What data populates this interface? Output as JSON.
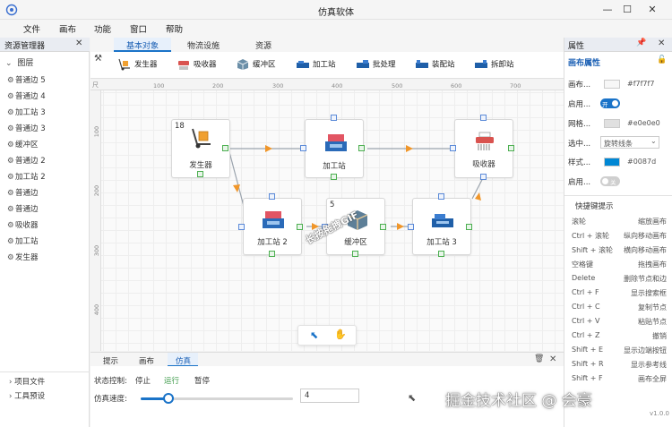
{
  "window": {
    "title": "仿真软体",
    "minimize": "—",
    "maximize": "☐",
    "close": "✕"
  },
  "menu": [
    "文件",
    "画布",
    "功能",
    "窗口",
    "帮助"
  ],
  "left_panel": {
    "title": "资源管理器",
    "group": "图层",
    "items": [
      "普通边 5",
      "普通边 4",
      "加工站 3",
      "普通边 3",
      "缓冲区",
      "普通边 2",
      "加工站 2",
      "普通边",
      "普通边",
      "吸收器",
      "加工站",
      "发生器"
    ],
    "footer_items": [
      "项目文件",
      "工具预设"
    ]
  },
  "tabs": [
    "基本对象",
    "物流设施",
    "资源"
  ],
  "toolbar": [
    "发生器",
    "吸收器",
    "缓冲区",
    "加工站",
    "批处理",
    "装配站",
    "拆卸站"
  ],
  "ruler": {
    "top": [
      "100",
      "200",
      "300",
      "400",
      "500",
      "600",
      "700"
    ],
    "left": [
      "100",
      "200",
      "300",
      "400"
    ],
    "corner": "尺"
  },
  "nodes": {
    "generator": {
      "label": "发生器",
      "count": "18"
    },
    "station1": {
      "label": "加工站"
    },
    "absorber": {
      "label": "吸收器"
    },
    "station2": {
      "label": "加工站 2"
    },
    "buffer": {
      "label": "缓冲区",
      "count": "5"
    },
    "station3": {
      "label": "加工站 3"
    }
  },
  "stamp": "长按拖拽GIF",
  "bottom": {
    "tabs": [
      "提示",
      "画布",
      "仿真"
    ],
    "state_label": "状态控制:",
    "stop": "停止",
    "run": "运行",
    "pause": "暂停",
    "speed_label": "仿真速度:",
    "speed_value": "4",
    "speed_fraction": 0.18
  },
  "right_panel": {
    "title": "属性",
    "subtitle": "画布属性",
    "props": [
      {
        "label": "画布...",
        "value": "#f7f7f7",
        "swatch": "#f7f7f7"
      },
      {
        "label": "启用...",
        "value": "开",
        "toggle": true
      },
      {
        "label": "网格...",
        "value": "#e0e0e0",
        "swatch": "#e0e0e0"
      },
      {
        "label": "选中...",
        "value": "旋转线条"
      },
      {
        "label": "样式...",
        "value": "#0087d",
        "swatch": "#0087d4"
      },
      {
        "label": "启用...",
        "value": "关",
        "toggle": false
      }
    ],
    "shortcut_title": "快捷键提示",
    "shortcuts": [
      {
        "key": "滚轮",
        "desc": "缩放画布"
      },
      {
        "key": "Ctrl + 滚轮",
        "desc": "纵向移动画布"
      },
      {
        "key": "Shift + 滚轮",
        "desc": "横向移动画布"
      },
      {
        "key": "空格键",
        "desc": "拖拽画布"
      },
      {
        "key": "Delete",
        "desc": "删除节点和边"
      },
      {
        "key": "Ctrl + F",
        "desc": "显示搜索框"
      },
      {
        "key": "Ctrl + C",
        "desc": "复制节点"
      },
      {
        "key": "Ctrl + V",
        "desc": "粘贴节点"
      },
      {
        "key": "Ctrl + Z",
        "desc": "撤销"
      },
      {
        "key": "Shift + E",
        "desc": "显示边端按钮"
      },
      {
        "key": "Shift + R",
        "desc": "显示参考线"
      },
      {
        "key": "Shift + F",
        "desc": "画布全屏"
      }
    ],
    "version": "v1.0.0"
  },
  "watermark": "掘金技术社区 @ 会豪"
}
